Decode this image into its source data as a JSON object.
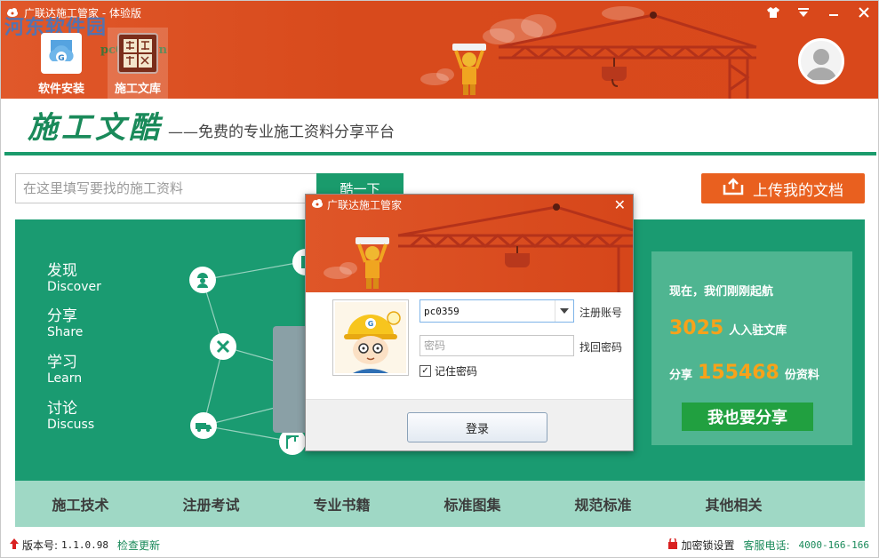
{
  "window": {
    "title": "广联达施工管家 - 体验版",
    "controls": [
      "shirt-icon",
      "dropdown-icon",
      "minimize-icon",
      "close-icon"
    ]
  },
  "watermark": {
    "text": "河东软件园",
    "url": "pc0359.cn"
  },
  "nav": {
    "tabs": [
      {
        "label": "软件安装",
        "icon": "cloud-install-icon"
      },
      {
        "label": "施工文库",
        "icon": "library-icon"
      }
    ]
  },
  "brand": {
    "logo": "施工文酷",
    "slogan": "——免费的专业施工资料分享平台"
  },
  "search": {
    "placeholder": "在这里填写要找的施工资料",
    "button": "酷一下"
  },
  "upload": {
    "label": "上传我的文档"
  },
  "hero": {
    "items": [
      {
        "zh": "发现",
        "en": "Discover"
      },
      {
        "zh": "分享",
        "en": "Share"
      },
      {
        "zh": "学习",
        "en": "Learn"
      },
      {
        "zh": "讨论",
        "en": "Discuss"
      }
    ]
  },
  "stats": {
    "intro": "现在，我们刚刚起航",
    "users_count": "3025",
    "users_suffix": "人入驻文库",
    "share_prefix": "分享",
    "docs_count": "155468",
    "docs_suffix": "份资料",
    "share_button": "我也要分享"
  },
  "categories": [
    "施工技术",
    "注册考试",
    "专业书籍",
    "标准图集",
    "规范标准",
    "其他相关"
  ],
  "status": {
    "version_label": "版本号:",
    "version": "1.1.0.98",
    "check_update": "检查更新",
    "lock_setting": "加密锁设置",
    "service_label": "客服电话:",
    "service_phone": "4000-166-166"
  },
  "login": {
    "title": "广联达施工管家",
    "username": "pc0359",
    "register": "注册账号",
    "password_placeholder": "密码",
    "recover": "找回密码",
    "remember": "记住密码",
    "remember_checked": true,
    "submit": "登录"
  },
  "colors": {
    "header": "#d84a1c",
    "brand_green": "#1a9b71",
    "stats_bg": "#4fb591",
    "accent_orange": "#e9601f",
    "number_orange": "#f7a21a",
    "share_green": "#21a040",
    "category_bg": "#9fd8c5"
  }
}
